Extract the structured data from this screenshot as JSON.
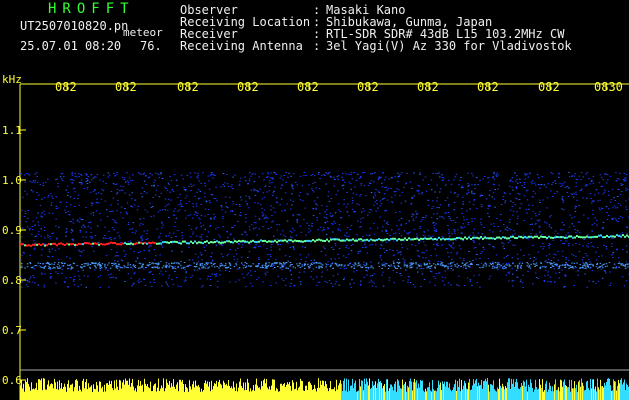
{
  "header": {
    "station_name": "HROFFT",
    "file_name": "UT2507010820.pn",
    "event_label": "meteor",
    "timestamp": "25.07.01 08:20",
    "count": "76."
  },
  "metadata": [
    {
      "label": "Observer",
      "value": "Masaki Kano"
    },
    {
      "label": "Receiving Location",
      "value": "Shibukawa, Gunma, Japan"
    },
    {
      "label": "Receiver",
      "value": "RTL-SDR SDR# 43dB L15 103.2MHz CW"
    },
    {
      "label": "Receiving Antenna",
      "value": "3el Yagi(V) Az 330 for Vladivostok"
    }
  ],
  "axes": {
    "y_unit": "kHz",
    "y_ticks": [
      "1.1",
      "1.0",
      "0.9",
      "0.8",
      "0.7",
      "0.6"
    ],
    "x_ticks": [
      "082",
      "082",
      "082",
      "082",
      "082",
      "082",
      "082",
      "082",
      "082",
      "0830"
    ]
  },
  "colors": {
    "header_green": "#33ff33",
    "meta_white": "#f0f0f0",
    "axis_yellow": "#ffff33",
    "spectrum_blue": "#1a3aff",
    "signal_red": "#ff2020",
    "baseline_cyan": "#33ddff"
  }
}
